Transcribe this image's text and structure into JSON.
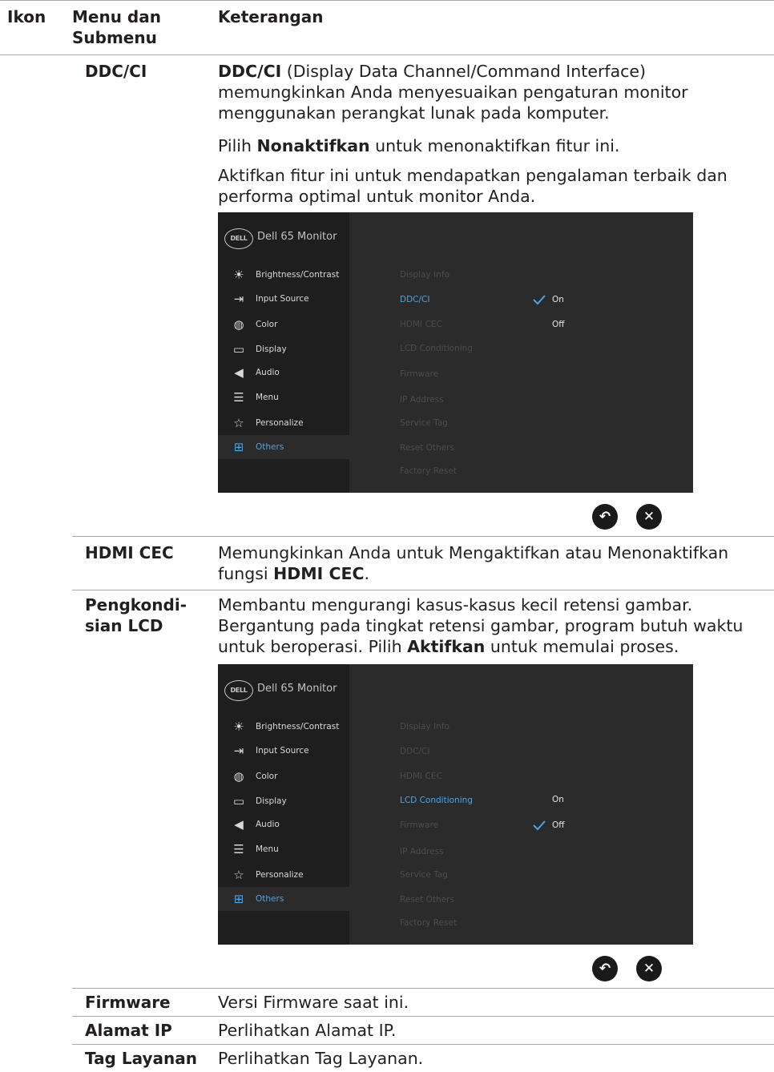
{
  "header": {
    "col1": "Ikon",
    "col2": "Menu dan Submenu",
    "col3": "Keterangan"
  },
  "ddc": {
    "term": "DDC/CI",
    "p1_bold": "DDC/CI",
    "p1_rest": " (Display Data Channel/Command Interface) memungkinkan Anda menyesuaikan pengaturan monitor menggunakan perangkat lunak pada komputer.",
    "p2_pre": "Pilih ",
    "p2_bold": "Nonaktifkan",
    "p2_post": " untuk menonaktifkan fitur ini.",
    "p3": "Aktifkan fitur ini untuk mendapatkan pengalaman terbaik dan performa optimal untuk monitor Anda."
  },
  "osd_common": {
    "logo": "DELL",
    "model": "Dell 65 Monitor",
    "menu": [
      "Brightness/Contrast",
      "Input Source",
      "Color",
      "Display",
      "Audio",
      "Menu",
      "Personalize",
      "Others"
    ],
    "submenu": [
      "Display Info",
      "DDC/CI",
      "HDMI CEC",
      "LCD Conditioning",
      "Firmware",
      "IP Address",
      "Service Tag",
      "Reset Others",
      "Factory Reset"
    ]
  },
  "osd1": {
    "active_submenu": "DDC/CI",
    "option_on": "On",
    "option_off": "Off",
    "selected": "On"
  },
  "osd2": {
    "active_submenu": "LCD Conditioning",
    "option_on": "On",
    "option_off": "Off",
    "selected": "Off"
  },
  "nav_buttons": {
    "back_icon": "back-arrow-icon",
    "close_icon": "close-icon"
  },
  "hdmi": {
    "term": "HDMI CEC",
    "text_pre": "Memungkinkan Anda untuk Mengaktifkan atau Menonaktifkan fungsi ",
    "text_bold": "HDMI CEC",
    "text_post": "."
  },
  "lcd": {
    "term": "Pengkondi-sian LCD",
    "text_pre": "Membantu mengurangi kasus-kasus kecil retensi gambar. Bergantung pada tingkat retensi gambar, program butuh waktu untuk beroperasi. Pilih ",
    "text_bold": "Aktifkan",
    "text_post": " untuk memulai proses."
  },
  "rows": [
    {
      "term": "Firmware",
      "desc": "Versi Firmware saat ini."
    },
    {
      "term": "Alamat IP",
      "desc": "Perlihatkan Alamat IP."
    },
    {
      "term": "Tag Layanan",
      "desc": "Perlihatkan Tag Layanan."
    }
  ]
}
